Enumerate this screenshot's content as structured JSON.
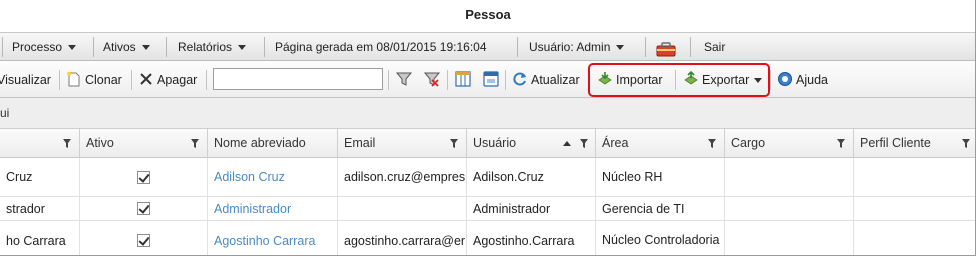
{
  "window": {
    "title": "Pessoa"
  },
  "menubar": {
    "items": [
      {
        "label": "Processo",
        "has_caret": true
      },
      {
        "label": "Ativos",
        "has_caret": true
      },
      {
        "label": "Relatórios",
        "has_caret": true
      }
    ],
    "generated_text": "Página gerada em 08/01/2015 19:16:04",
    "user_label": "Usuário: Admin",
    "toolbox_icon": "toolbox-icon",
    "exit_label": "Sair"
  },
  "toolbar": {
    "view_label": "Visualizar",
    "clone_label": "Clonar",
    "delete_label": "Apagar",
    "search_value": "",
    "refresh_label": "Atualizar",
    "import_label": "Importar",
    "export_label": "Exportar",
    "help_label": "Ajuda",
    "highlight_color": "#e0101a"
  },
  "groupbar": {
    "text": "ui"
  },
  "grid": {
    "columns": [
      {
        "label": ""
      },
      {
        "label": "Ativo"
      },
      {
        "label": "Nome abreviado"
      },
      {
        "label": "Email"
      },
      {
        "label": "Usuário"
      },
      {
        "label": "Área"
      },
      {
        "label": "Cargo"
      },
      {
        "label": "Perfil Cliente"
      }
    ],
    "rows": [
      {
        "name": "Cruz",
        "active": true,
        "short_name": "Adilson Cruz",
        "email": "adilson.cruz@empres",
        "user": "Adilson.Cruz",
        "area": "Núcleo RH",
        "cargo": "",
        "perfil": ""
      },
      {
        "name": "strador",
        "active": true,
        "short_name": "Administrador",
        "email": "",
        "user": "Administrador",
        "area": "Gerencia de TI",
        "cargo": "",
        "perfil": ""
      },
      {
        "name": "ho Carrara",
        "active": true,
        "short_name": "Agostinho Carrara",
        "email": "agostinho.carrara@er",
        "user": "Agostinho.Carrara",
        "area": "Núcleo Controladoria",
        "cargo": "",
        "perfil": ""
      }
    ],
    "link_color": "#4a8bc2"
  }
}
